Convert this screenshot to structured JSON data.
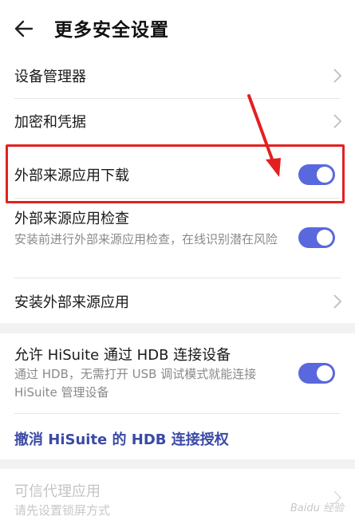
{
  "header": {
    "title": "更多安全设置",
    "back_icon": "arrow-left-icon"
  },
  "section1": {
    "items": [
      {
        "label": "设备管理器",
        "control": "chevron"
      },
      {
        "label": "加密和凭据",
        "control": "chevron"
      },
      {
        "label": "外部来源应用下载",
        "control": "toggle",
        "on": true
      },
      {
        "label": "外部来源应用检查",
        "sub": "安装前进行外部来源应用检查，在线识别潜在风险",
        "control": "toggle",
        "on": true
      },
      {
        "label": "安装外部来源应用",
        "control": "chevron"
      }
    ]
  },
  "section2": {
    "hisuite_title": "允许 HiSuite 通过 HDB 连接设备",
    "hisuite_sub": "通过 HDB，无需打开 USB 调试模式就能连接 HiSuite 管理设备",
    "hisuite_on": true,
    "revoke_link": "撤消 HiSuite 的 HDB 连接授权"
  },
  "section3": {
    "trusted_title": "可信代理应用",
    "trusted_sub": "请先设置锁屏方式"
  },
  "colors": {
    "accent": "#5a68dd",
    "link": "#3b4aa6",
    "highlight": "#e32020"
  },
  "watermark": "Baidu 经验"
}
